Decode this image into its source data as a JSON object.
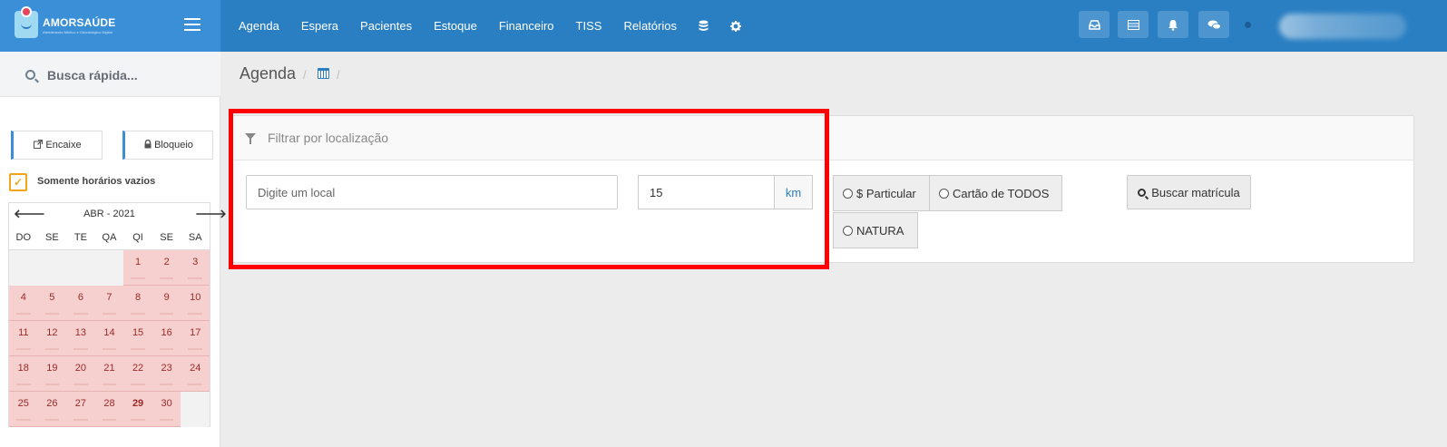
{
  "brand": {
    "name": "AMORSAÚDE",
    "tagline": "Atendimento Médico e Odontológico Digital"
  },
  "nav": {
    "items": [
      {
        "label": "Agenda"
      },
      {
        "label": "Espera"
      },
      {
        "label": "Pacientes"
      },
      {
        "label": "Estoque"
      },
      {
        "label": "Financeiro"
      },
      {
        "label": "TISS"
      },
      {
        "label": "Relatórios"
      }
    ],
    "database_icon": "database-icon",
    "settings_icon": "gear-icon"
  },
  "toolbar": {
    "icons": [
      "inbox-icon",
      "list-icon",
      "bell-icon",
      "chat-icon"
    ]
  },
  "sidebar": {
    "search_placeholder": "Busca rápida...",
    "encaixe_label": "Encaixe",
    "bloqueio_label": "Bloqueio",
    "only_empty_label": "Somente horários vazios",
    "only_empty_checked": true
  },
  "calendar": {
    "title": "ABR - 2021",
    "weekdays": [
      "DO",
      "SE",
      "TE",
      "QA",
      "QI",
      "SE",
      "SA"
    ],
    "leading_blanks": 4,
    "days": [
      "1",
      "2",
      "3",
      "4",
      "5",
      "6",
      "7",
      "8",
      "9",
      "10",
      "11",
      "12",
      "13",
      "14",
      "15",
      "16",
      "17",
      "18",
      "19",
      "20",
      "21",
      "22",
      "23",
      "24",
      "25",
      "26",
      "27",
      "28",
      "29",
      "30"
    ],
    "bold_day": "29"
  },
  "breadcrumb": {
    "title": "Agenda",
    "separator": "/"
  },
  "filter": {
    "title": "Filtrar por localização",
    "location_placeholder": "Digite um local",
    "radius_value": "15",
    "radius_unit": "km"
  },
  "options": {
    "particular": "$ Particular",
    "cartao": "Cartão de TODOS",
    "natura": "NATURA"
  },
  "actions": {
    "buscar_label": "Buscar matrícula"
  },
  "colors": {
    "primary": "#2a7fc2",
    "accent": "#f4a41c",
    "highlight": "#ff0000",
    "calendar_day": "#f6cfcf"
  }
}
